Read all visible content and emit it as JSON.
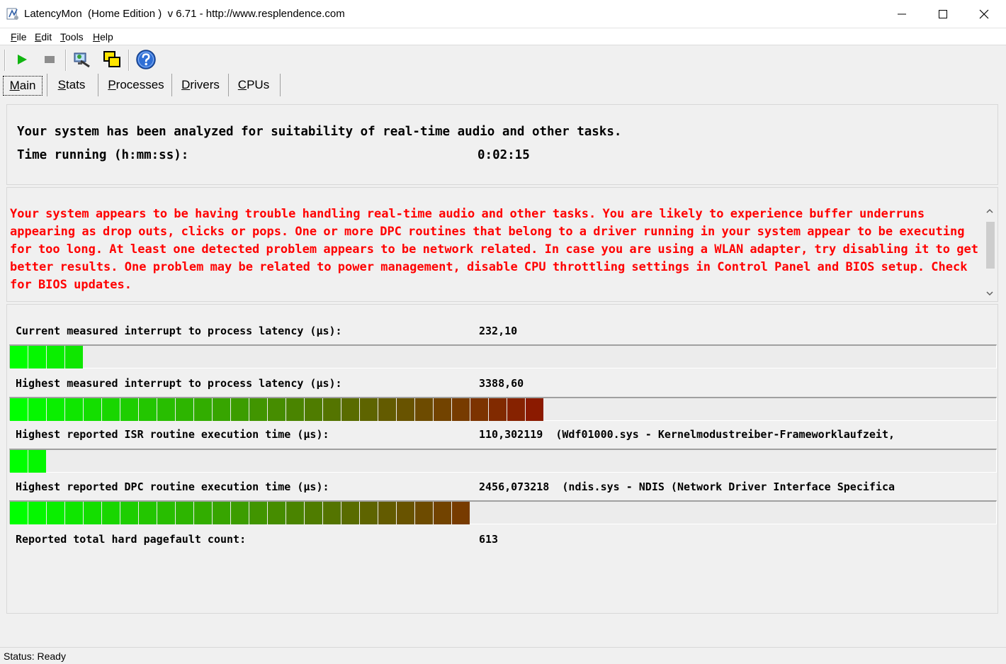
{
  "window": {
    "title": "LatencyMon  (Home Edition )  v 6.71 - http://www.resplendence.com",
    "controls": [
      "minimize",
      "maximize",
      "close"
    ]
  },
  "menu": {
    "items": [
      {
        "key": "F",
        "rest": "ile"
      },
      {
        "key": "E",
        "rest": "dit"
      },
      {
        "key": "T",
        "rest": "ools"
      },
      {
        "key": "H",
        "rest": "elp"
      }
    ]
  },
  "toolbar": {
    "buttons": [
      "play-icon",
      "stop-icon",
      "driver-tool-icon",
      "windows-icon",
      "help-icon"
    ]
  },
  "tabs": [
    {
      "key": "M",
      "rest": "ain",
      "active": true
    },
    {
      "key": "S",
      "rest": "tats",
      "active": false
    },
    {
      "key": "P",
      "rest": "rocesses",
      "active": false
    },
    {
      "key": "D",
      "rest": "rivers",
      "active": false
    },
    {
      "key": "C",
      "rest": "PUs",
      "active": false
    }
  ],
  "summary": {
    "line1": "Your system has been analyzed for suitability of real-time audio and other tasks.",
    "time_label": "Time running (h:mm:ss):",
    "time_value": "0:02:15"
  },
  "warning": {
    "text": "Your system appears to be having trouble handling real-time audio and other tasks. You are likely to experience buffer underruns appearing as drop outs, clicks or pops. One or more DPC routines that belong to a driver running in your system appear to be executing for too long. At least one detected problem appears to be network related. In case you are using a WLAN adapter, try disabling it to get better results. One problem may be related to power management, disable CPU throttling settings in Control Panel and BIOS setup. Check for BIOS updates.",
    "color": "#ff0000"
  },
  "metrics": [
    {
      "label": "Current measured interrupt to process latency (µs):",
      "value": "232,10",
      "detail": "",
      "segments": 4
    },
    {
      "label": "Highest measured interrupt to process latency (µs):",
      "value": "3388,60",
      "detail": "",
      "segments": 29
    },
    {
      "label": "Highest reported ISR routine execution time (µs):",
      "value": "110,302119",
      "detail": "(Wdf01000.sys - Kernelmodustreiber-Frameworklaufzeit,",
      "segments": 2
    },
    {
      "label": "Highest reported DPC routine execution time (µs):",
      "value": "2456,073218",
      "detail": "(ndis.sys - NDIS (Network Driver Interface Specifica",
      "segments": 25
    },
    {
      "label": "Reported total hard pagefault count:",
      "value": "613",
      "detail": "",
      "segments": 0
    }
  ],
  "meter_colors": {
    "start": "#00ff00",
    "end": "#8b1a00"
  },
  "status": {
    "text": "Status: Ready"
  }
}
